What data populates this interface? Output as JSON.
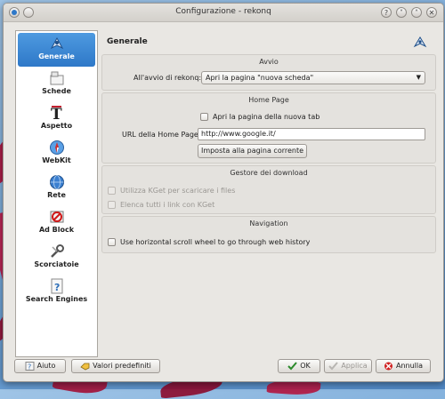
{
  "window": {
    "title": "Configurazione - rekonq",
    "buttons": [
      "?",
      "˅",
      "˄",
      "✕"
    ]
  },
  "sidebar": {
    "items": [
      {
        "label": "Generale",
        "icon": "rekonq-icon",
        "selected": true
      },
      {
        "label": "Schede",
        "icon": "tabs-icon"
      },
      {
        "label": "Aspetto",
        "icon": "font-icon"
      },
      {
        "label": "WebKit",
        "icon": "webkit-compass-icon"
      },
      {
        "label": "Rete",
        "icon": "network-icon"
      },
      {
        "label": "Ad Block",
        "icon": "adblock-icon"
      },
      {
        "label": "Scorciatoie",
        "icon": "shortcuts-icon"
      },
      {
        "label": "Search Engines",
        "icon": "search-engines-icon"
      }
    ]
  },
  "header": {
    "title": "Generale"
  },
  "groups": {
    "startup": {
      "title": "Avvio",
      "label": "All'avvio di rekonq:",
      "value": "Apri la pagina \"nuova scheda\""
    },
    "homepage": {
      "title": "Home Page",
      "new_tab_checkbox": "Apri la pagina della nuova tab",
      "url_label": "URL della Home Page:",
      "url_value": "http://www.google.it/",
      "set_current_button": "Imposta alla pagina corrente"
    },
    "downloads": {
      "title": "Gestore dei download",
      "kget_checkbox": "Utilizza KGet per scaricare i files",
      "kget_links_checkbox": "Elenca tutti i link con KGet"
    },
    "navigation": {
      "title": "Navigation",
      "scroll_checkbox": "Use horizontal scroll wheel to go through web history"
    }
  },
  "footer": {
    "help_button": "Aiuto",
    "defaults_button": "Valori predefiniti",
    "ok_button": "OK",
    "apply_button": "Applica",
    "cancel_button": "Annulla"
  },
  "colors": {
    "accent": "#2e78c8",
    "window_bg": "#e9e7e3"
  }
}
